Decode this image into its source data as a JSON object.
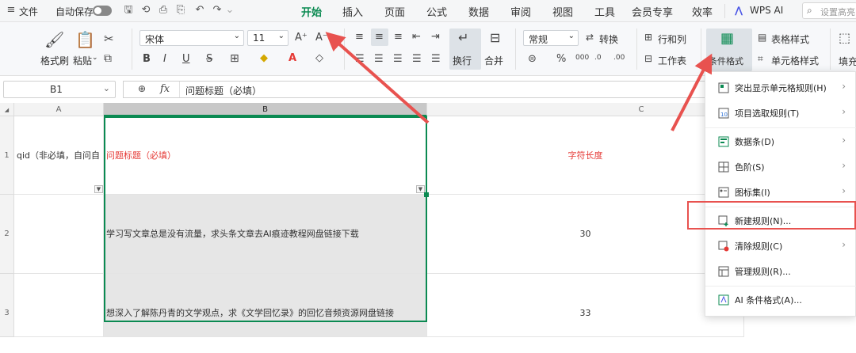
{
  "menubar": {
    "file": "文件",
    "autosave": "自动保存",
    "tabs": [
      "开始",
      "插入",
      "页面",
      "公式",
      "数据",
      "审阅",
      "视图",
      "工具",
      "会员专享",
      "效率"
    ],
    "active_tab": "开始",
    "wps_ai": "WPS AI",
    "search_placeholder": "设置高亮"
  },
  "ribbon": {
    "format_painter": "格式刷",
    "paste": "粘贴",
    "font_name": "宋体",
    "font_size": "11",
    "wrap": "换行",
    "merge": "合并",
    "number_format": "常规",
    "convert": "转换",
    "row_col": "行和列",
    "worksheet": "工作表",
    "cond_format": "条件格式",
    "table_style": "表格样式",
    "cell_style": "单元格样式",
    "fill": "填充"
  },
  "formula_bar": {
    "name_box": "B1",
    "fx": "fx",
    "content": "问题标题（必填）"
  },
  "sheet": {
    "col_a": "A",
    "col_b": "B",
    "col_c": "C",
    "rows": [
      {
        "num": "1",
        "a": "qid（非必填，自问自",
        "b": "问题标题（必填）",
        "c": "字符长度"
      },
      {
        "num": "2",
        "a": "",
        "b": "学习写文章总是没有流量，求头条文章去AI痕迹教程网盘链接下载",
        "c": "30"
      },
      {
        "num": "3",
        "a": "",
        "b": "想深入了解陈丹青的文学观点，求《文学回忆录》的回忆音频资源网盘链接",
        "c": "33"
      }
    ]
  },
  "menu": {
    "items": [
      {
        "label": "突出显示单元格规则(H)",
        "submenu": true
      },
      {
        "label": "项目选取规则(T)",
        "submenu": true
      },
      {
        "label": "数据条(D)",
        "submenu": true
      },
      {
        "label": "色阶(S)",
        "submenu": true
      },
      {
        "label": "图标集(I)",
        "submenu": true
      },
      {
        "label": "新建规则(N)...",
        "submenu": false
      },
      {
        "label": "清除规则(C)",
        "submenu": true
      },
      {
        "label": "管理规则(R)...",
        "submenu": false
      },
      {
        "label": "AI 条件格式(A)...",
        "submenu": false
      }
    ]
  },
  "colors": {
    "accent": "#0b8a52",
    "highlight_red": "#e53935",
    "arrow": "#e8524f"
  }
}
